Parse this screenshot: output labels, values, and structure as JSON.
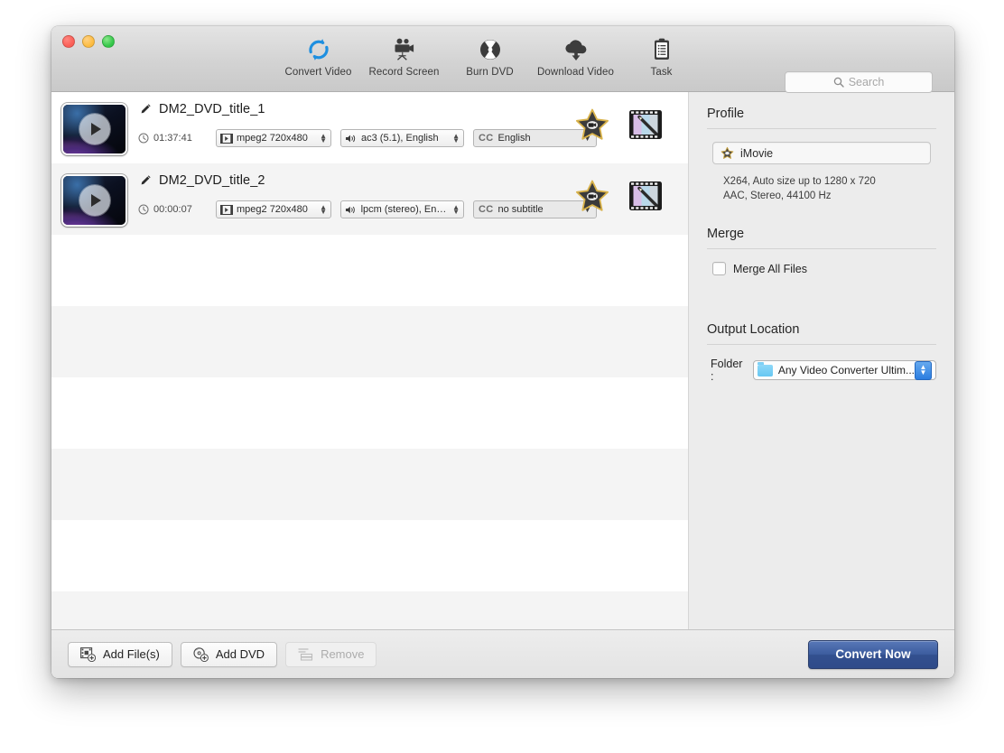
{
  "window": {
    "traffic_lights": [
      "close",
      "minimize",
      "zoom"
    ]
  },
  "toolbar": {
    "items": [
      {
        "label": "Convert Video",
        "icon": "convert-video-icon"
      },
      {
        "label": "Record Screen",
        "icon": "record-screen-icon"
      },
      {
        "label": "Burn DVD",
        "icon": "burn-dvd-icon"
      },
      {
        "label": "Download Video",
        "icon": "download-video-icon"
      },
      {
        "label": "Task",
        "icon": "task-icon"
      }
    ],
    "search": {
      "placeholder": "Search",
      "value": "",
      "icon": "search-icon"
    }
  },
  "filelist": {
    "rows": [
      {
        "title": "DM2_DVD_title_1",
        "duration": "01:37:41",
        "video": "mpeg2 720x480",
        "audio": "ac3 (5.1), English",
        "subtitle_prefix": "CC",
        "subtitle": "English",
        "actions": [
          "imovie-star-icon",
          "video-edit-icon"
        ]
      },
      {
        "title": "DM2_DVD_title_2",
        "duration": "00:00:07",
        "video": "mpeg2 720x480",
        "audio": "lpcm (stereo), Engl...",
        "subtitle_prefix": "CC",
        "subtitle": "no subtitle",
        "actions": [
          "imovie-star-icon",
          "video-edit-icon"
        ]
      }
    ],
    "empty_row_count": 6
  },
  "panel": {
    "profile": {
      "heading": "Profile",
      "name": "iMovie",
      "icon": "imovie-star-icon",
      "description_line1": "X264, Auto size up to 1280 x 720",
      "description_line2": "AAC, Stereo, 44100 Hz"
    },
    "merge": {
      "heading": "Merge",
      "checkbox_label": "Merge All Files",
      "checked": false
    },
    "output": {
      "heading": "Output Location",
      "folder_label": "Folder :",
      "folder_value": "Any Video Converter Ultim...",
      "folder_icon": "folder-icon"
    }
  },
  "bottombar": {
    "add_files": {
      "label": "Add File(s)",
      "icon": "add-files-icon",
      "disabled": false
    },
    "add_dvd": {
      "label": "Add DVD",
      "icon": "add-dvd-icon",
      "disabled": false
    },
    "remove": {
      "label": "Remove",
      "icon": "remove-icon",
      "disabled": true
    },
    "convert": {
      "label": "Convert Now"
    }
  },
  "colors": {
    "accent_blue": "#2f4b89",
    "toolbar_icon_blue": "#1e8fe0",
    "window_chrome": "#ececec",
    "row_alt": "#f4f4f4"
  }
}
